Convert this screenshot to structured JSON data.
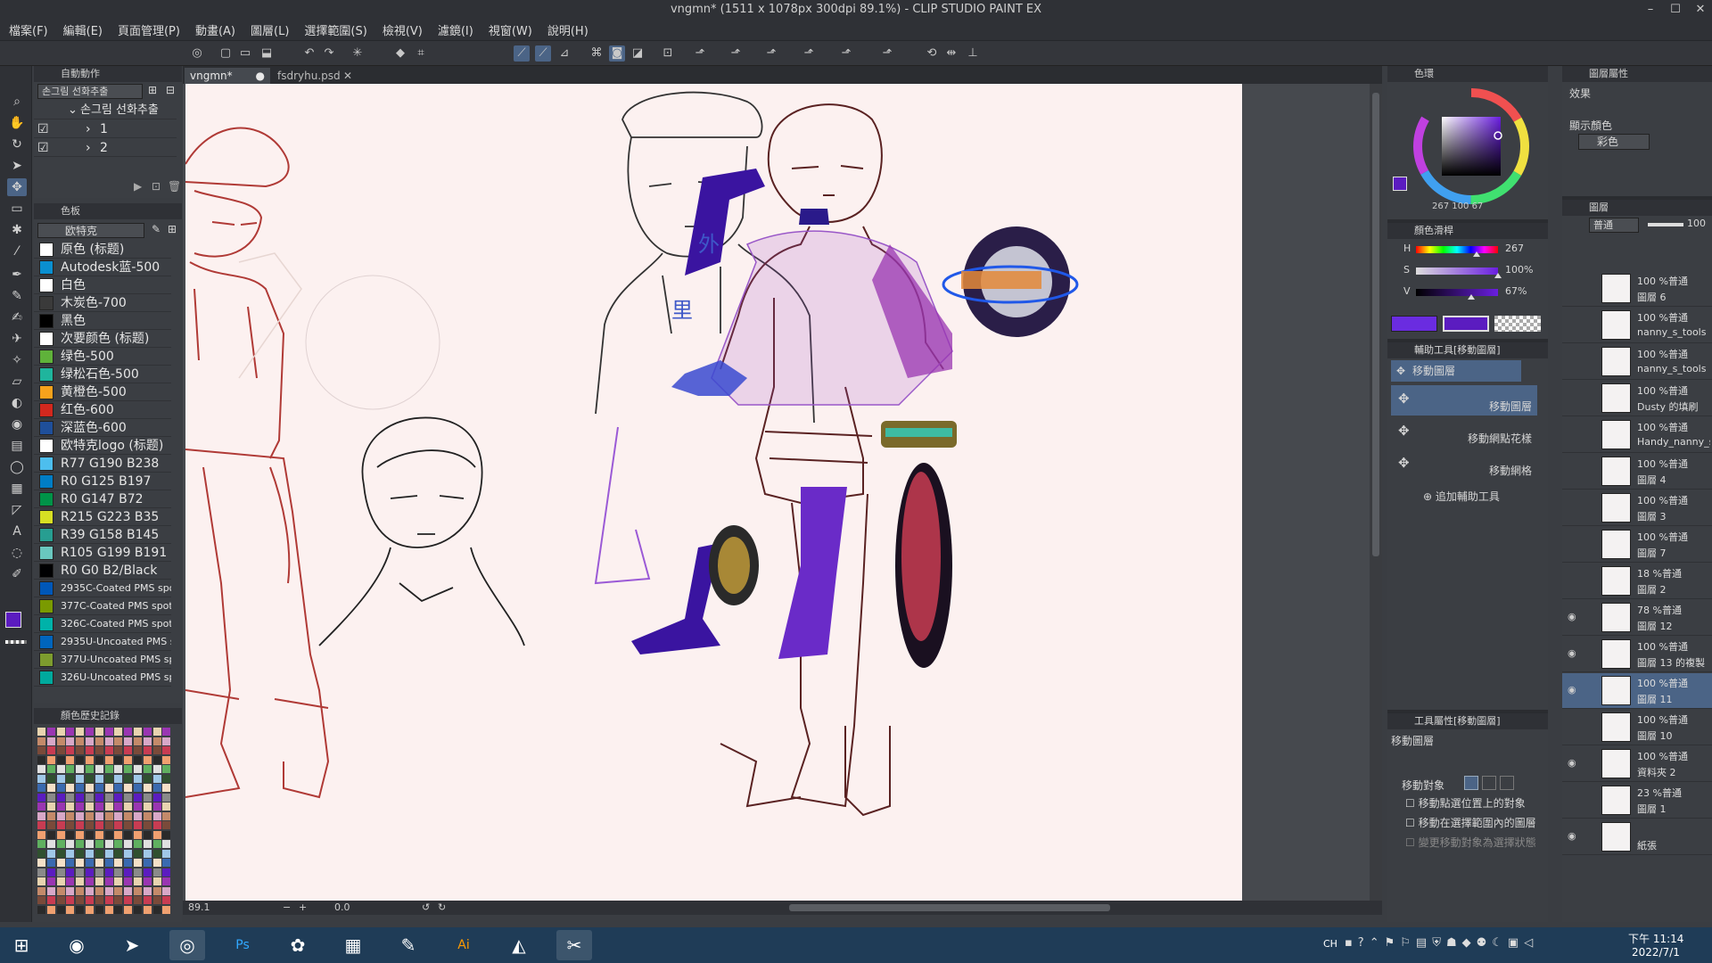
{
  "title": "vngmn* (1511 x 1078px 300dpi 89.1%) - CLIP STUDIO PAINT EX",
  "menu": [
    "檔案(F)",
    "編輯(E)",
    "頁面管理(P)",
    "動畫(A)",
    "圖層(L)",
    "選擇範圍(S)",
    "檢視(V)",
    "濾鏡(I)",
    "視窗(W)",
    "說明(H)"
  ],
  "auto_action": {
    "header": "自動動作",
    "set": "손그림 선화추출",
    "group": "손그림 선화추출",
    "items": [
      "1",
      "2"
    ]
  },
  "color_set": {
    "header": "色板",
    "set": "欧特克",
    "colors": [
      {
        "label": "原色 (标题)",
        "color": "#ffffff"
      },
      {
        "label": "Autodesk蓝-500",
        "color": "#0a8fd0"
      },
      {
        "label": "白色",
        "color": "#ffffff"
      },
      {
        "label": "木炭色-700",
        "color": "#3a3a3a"
      },
      {
        "label": "黑色",
        "color": "#000000"
      },
      {
        "label": "次要颜色 (标题)",
        "color": "#ffffff"
      },
      {
        "label": "绿色-500",
        "color": "#5fb23a"
      },
      {
        "label": "绿松石色-500",
        "color": "#1fb59d"
      },
      {
        "label": "黄橙色-500",
        "color": "#f6a21c"
      },
      {
        "label": "红色-600",
        "color": "#d2281e"
      },
      {
        "label": "深蓝色-600",
        "color": "#1f4f9a"
      },
      {
        "label": "欧特克logo (标题)",
        "color": "#ffffff"
      },
      {
        "label": "R77 G190 B238",
        "color": "#4dbeee"
      },
      {
        "label": "R0 G125 B197",
        "color": "#007dc5"
      },
      {
        "label": "R0 G147 B72",
        "color": "#009348"
      },
      {
        "label": "R215 G223 B35",
        "color": "#d7df23"
      },
      {
        "label": "R39 G158 B145",
        "color": "#279e91"
      },
      {
        "label": "R105 G199 B191",
        "color": "#69c7bf"
      },
      {
        "label": "R0 G0 B2/Black",
        "color": "#000002"
      },
      {
        "label": "2935C-Coated PMS spot",
        "color": "#0057b8"
      },
      {
        "label": "377C-Coated PMS spot",
        "color": "#7a9a01"
      },
      {
        "label": "326C-Coated PMS spot",
        "color": "#00b2a9"
      },
      {
        "label": "2935U-Uncoated PMS sp",
        "color": "#0065bd"
      },
      {
        "label": "377U-Uncoated PMS sp",
        "color": "#7d9c2e"
      },
      {
        "label": "326U-Uncoated PMS sp",
        "color": "#00a99d"
      }
    ]
  },
  "color_history": {
    "header": "顏色歷史記錄"
  },
  "tabs": [
    "vngmn*",
    "fsdryhu.psd"
  ],
  "doodle": [
    "外",
    "里"
  ],
  "status": {
    "zoom": "89.1",
    "angle": "0.0"
  },
  "color_wheel": {
    "header": "色環",
    "h": "267",
    "s": "100",
    "v": "67",
    "current": "#5b1cc0"
  },
  "color_slider": {
    "header": "顏色滑桿",
    "h_label": "H",
    "s_label": "S",
    "v_label": "V",
    "h": "267",
    "s": "100%",
    "v": "67%",
    "h_frac": 0.74,
    "s_frac": 1.0,
    "v_frac": 0.67
  },
  "sub_tool": {
    "header": "輔助工具[移動圖層]",
    "group": "移動圖層",
    "items": [
      "移動圖層",
      "移動網點花樣",
      "移動網格"
    ],
    "add": "追加輔助工具"
  },
  "tool_property": {
    "header": "工具屬性[移動圖層]",
    "title": "移動圖層",
    "target_label": "移動對象",
    "options": [
      "移動點選位置上的對象",
      "移動在選擇範圍內的圖層",
      "變更移動對象為選擇狀態"
    ]
  },
  "layer_property": {
    "header": "圖層屬性",
    "effect": "效果",
    "display_color": "顯示顏色",
    "color_mode": "彩色"
  },
  "layers": {
    "header": "圖層",
    "blend": "普通",
    "opacity": "100",
    "items": [
      {
        "op": "100 %普通",
        "name": "圖層 6",
        "visible": false,
        "selected": false
      },
      {
        "op": "100 %普通",
        "name": "nanny_s_tools",
        "visible": false,
        "selected": false
      },
      {
        "op": "100 %普通",
        "name": "nanny_s_tools",
        "visible": false,
        "selected": false
      },
      {
        "op": "100 %普通",
        "name": "Dusty 的填刷",
        "visible": false,
        "selected": false
      },
      {
        "op": "100 %普通",
        "name": "Handy_nanny_s",
        "visible": false,
        "selected": false
      },
      {
        "op": "100 %普通",
        "name": "圖層 4",
        "visible": false,
        "selected": false
      },
      {
        "op": "100 %普通",
        "name": "圖層 3",
        "visible": false,
        "selected": false
      },
      {
        "op": "100 %普通",
        "name": "圖層 7",
        "visible": false,
        "selected": false
      },
      {
        "op": "18 %普通",
        "name": "圖層 2",
        "visible": false,
        "selected": false
      },
      {
        "op": "78 %普通",
        "name": "圖層 12",
        "visible": true,
        "selected": false
      },
      {
        "op": "100 %普通",
        "name": "圖層 13 的複製",
        "visible": true,
        "selected": false
      },
      {
        "op": "100 %普通",
        "name": "圖層 11",
        "visible": true,
        "selected": true
      },
      {
        "op": "100 %普通",
        "name": "圖層 10",
        "visible": false,
        "selected": false
      },
      {
        "op": "100 %普通",
        "name": "資料夾 2",
        "visible": true,
        "selected": false
      },
      {
        "op": "23 %普通",
        "name": "圖層 1",
        "visible": false,
        "selected": false
      },
      {
        "op": "",
        "name": "紙張",
        "visible": true,
        "selected": false
      }
    ]
  },
  "taskbar": {
    "lang": "CH",
    "time": "下午 11:14",
    "date": "2022/7/1"
  }
}
